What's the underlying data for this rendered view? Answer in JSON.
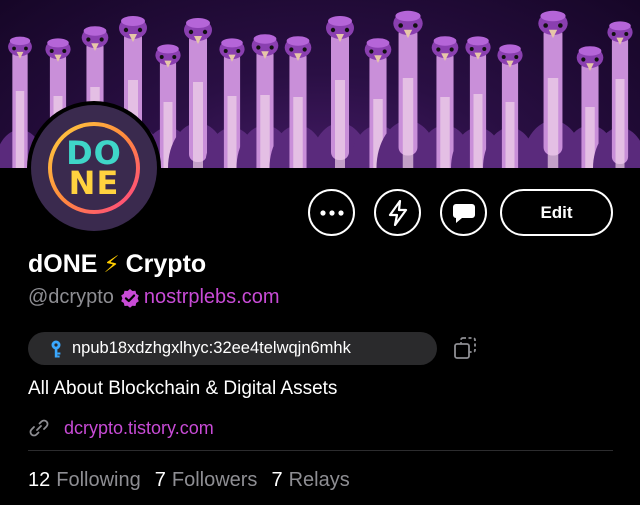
{
  "banner": {
    "image": "ostrich-flock-banner",
    "accent": "#a34fd1"
  },
  "avatar": {
    "logo_top": "DO",
    "logo_bottom": "NE"
  },
  "actions": {
    "more_icon": "ellipsis-icon",
    "zap_icon": "lightning-icon",
    "message_icon": "chat-bubble-icon",
    "edit_label": "Edit"
  },
  "profile": {
    "name_left": "dONE",
    "name_emoji": "⚡",
    "name_right": "Crypto",
    "handle": "@dcrypto",
    "nip05": "nostrplebs.com",
    "npub": "npub18xdzhgxlhyc:32ee4telwqjn6mhk",
    "about": "All About Blockchain & Digital Assets",
    "website": "dcrypto.tistory.com"
  },
  "stats": {
    "following_count": "12",
    "following_label": "Following",
    "followers_count": "7",
    "followers_label": "Followers",
    "relays_count": "7",
    "relays_label": "Relays"
  },
  "colors": {
    "background": "#000000",
    "accent": "#c84bd6",
    "muted": "#8e8e93",
    "pill": "#2a2a2c"
  }
}
